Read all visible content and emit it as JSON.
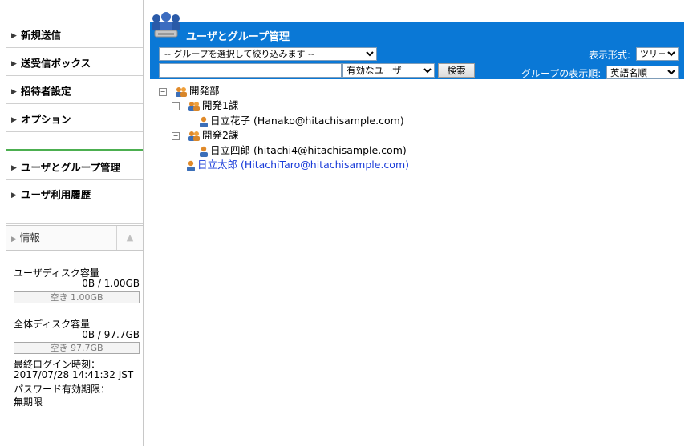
{
  "sidebar": {
    "items": [
      {
        "label": "新規送信"
      },
      {
        "label": "送受信ボックス"
      },
      {
        "label": "招待者設定"
      },
      {
        "label": "オプション"
      },
      {
        "label": "ユーザとグループ管理"
      },
      {
        "label": "ユーザ利用履歴"
      }
    ],
    "info": {
      "title": "情報",
      "user_disk_label": "ユーザディスク容量",
      "user_disk_usage": "0B / 1.00GB",
      "user_disk_free": "空き 1.00GB",
      "total_disk_label": "全体ディスク容量",
      "total_disk_usage": "0B / 97.7GB",
      "total_disk_free": "空き 97.7GB",
      "last_login_label": "最終ログイン時刻：",
      "last_login_value": "2017/07/28 14:41:32 JST",
      "password_expiry_label": "パスワード有効期限：",
      "password_expiry_value": "無期限"
    }
  },
  "header": {
    "title": "ユーザとグループ管理",
    "group_filter_value": "-- グループを選択して絞り込みます --",
    "search_value": "",
    "user_status_value": "有効なユーザ",
    "search_button": "検索",
    "display_format_label": "表示形式:",
    "display_format_value": "ツリー",
    "group_order_label": "グループの表示順:",
    "group_order_value": "英語名順"
  },
  "tree": {
    "root_group": "開発部",
    "subgroup1": "開発1課",
    "subgroup1_user": "日立花子 (Hanako@hitachisample.com)",
    "subgroup2": "開発2課",
    "subgroup2_user": "日立四郎 (hitachi4@hitachisample.com)",
    "root_user": "日立太郎 (HitachiTaro@hitachisample.com)"
  },
  "colors": {
    "header_blue": "#0a78d6",
    "active_underline": "#4caf50",
    "link_blue": "#1a3cd9"
  }
}
